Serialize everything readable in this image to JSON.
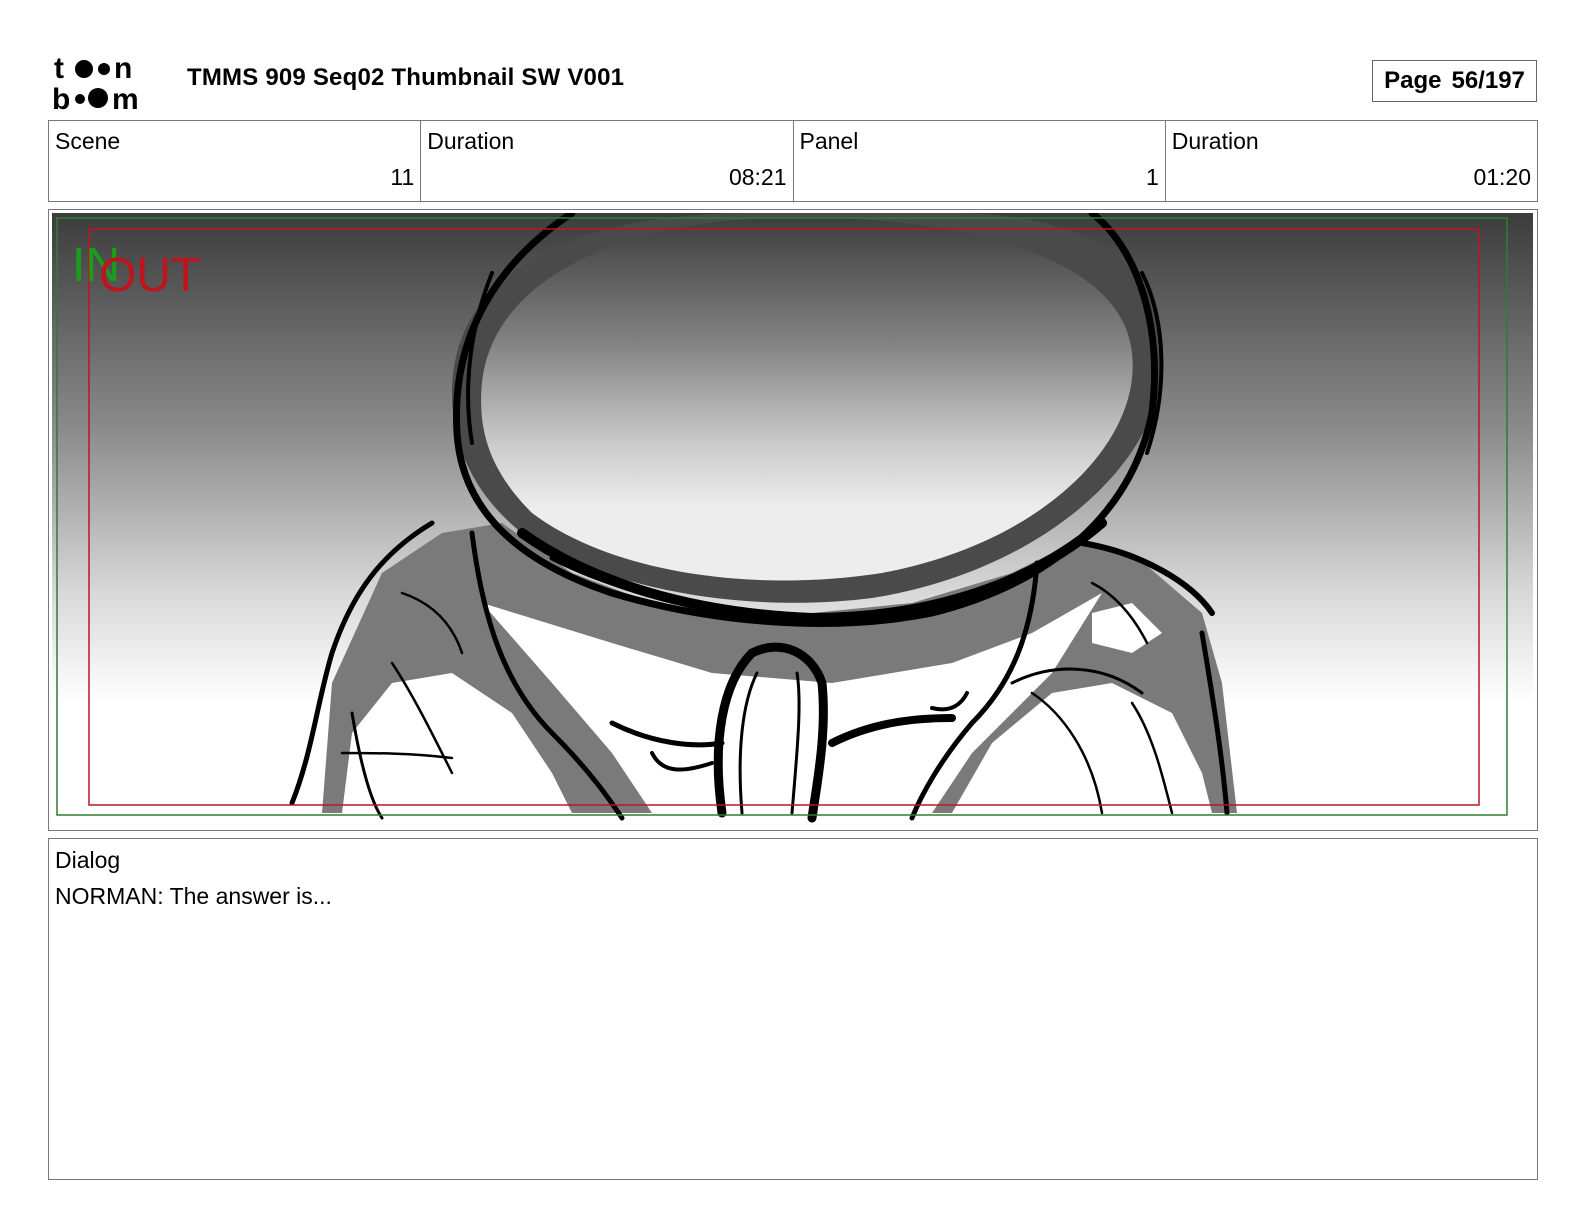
{
  "header": {
    "logo_text_top": "toon",
    "logo_text_bottom": "boom",
    "title": "TMMS 909 Seq02 Thumbnail SW V001",
    "page_label": "Page",
    "page_value": "56/197"
  },
  "info": {
    "scene_label": "Scene",
    "scene_value": "11",
    "scene_duration_label": "Duration",
    "scene_duration_value": "08:21",
    "panel_label": "Panel",
    "panel_value": "1",
    "panel_duration_label": "Duration",
    "panel_duration_value": "01:20"
  },
  "panel": {
    "in_marker": "IN",
    "out_marker": "OUT",
    "in_color": "#1a9e1a",
    "out_color": "#c0141c"
  },
  "dialog": {
    "label": "Dialog",
    "text": "NORMAN: The answer is..."
  }
}
